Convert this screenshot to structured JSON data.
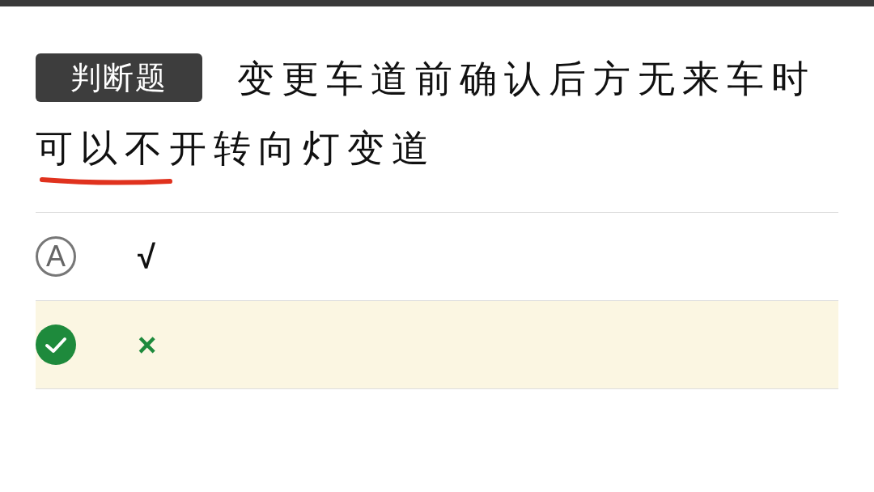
{
  "question": {
    "type_badge": "判断题",
    "text_lines": [
      "变更车道前确认后方无来车时",
      "可以不开转向灯变道"
    ],
    "underline_mark": true
  },
  "options": [
    {
      "letter": "A",
      "label": "√",
      "selected": false
    },
    {
      "label": "×",
      "selected": true
    }
  ]
}
